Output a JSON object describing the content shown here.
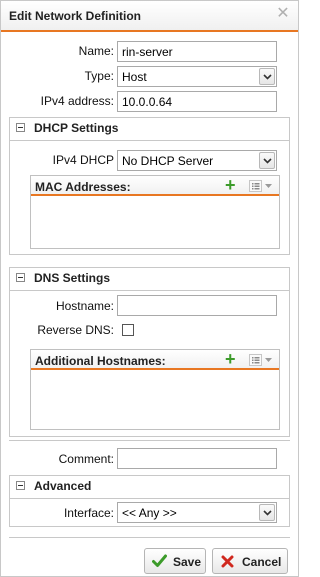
{
  "dialog": {
    "title": "Edit Network Definition",
    "close_glyph": "✕"
  },
  "fields": {
    "name_label": "Name:",
    "name_value": "rin-server",
    "type_label": "Type:",
    "type_value": "Host",
    "ipv4_label": "IPv4 address:",
    "ipv4_value": "10.0.0.64"
  },
  "dhcp": {
    "title": "DHCP Settings",
    "ipv4dhcp_label": "IPv4 DHCP",
    "ipv4dhcp_value": "No DHCP Server",
    "mac_grid_title": "MAC Addresses:"
  },
  "dns": {
    "title": "DNS Settings",
    "hostname_label": "Hostname:",
    "hostname_value": "",
    "reverse_label": "Reverse DNS:",
    "reverse_checked": false,
    "addl_grid_title": "Additional Hostnames:"
  },
  "comment": {
    "label": "Comment:",
    "value": ""
  },
  "advanced": {
    "title": "Advanced",
    "interface_label": "Interface:",
    "interface_value": "<< Any >>"
  },
  "buttons": {
    "save": "Save",
    "cancel": "Cancel"
  },
  "colors": {
    "accent": "#e87722",
    "save_check": "#3c9b2a",
    "cancel_x": "#d0281e"
  },
  "icons": [
    "close-icon",
    "chevron-down-icon",
    "collapse-toggle-icon",
    "add-icon",
    "list-menu-icon",
    "checkmark-icon",
    "x-icon"
  ]
}
